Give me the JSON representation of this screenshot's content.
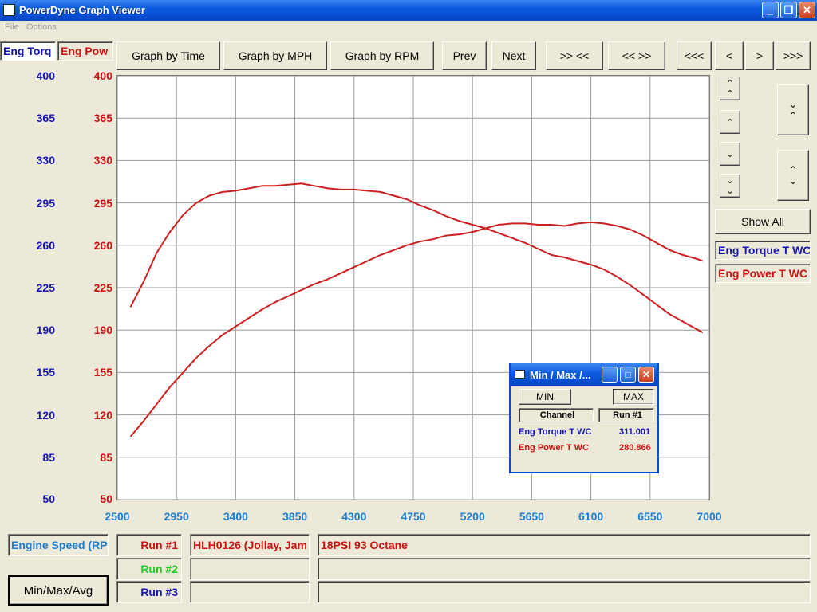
{
  "window": {
    "title": "PowerDyne Graph Viewer",
    "minimize": "_",
    "restore": "❐",
    "close": "✕"
  },
  "menu": {
    "file": "File",
    "options": "Options"
  },
  "tabs": {
    "torque": "Eng Torq",
    "power": "Eng Pow"
  },
  "toolbar": {
    "graph_time": "Graph by Time",
    "graph_mph": "Graph by MPH",
    "graph_rpm": "Graph by RPM",
    "prev": "Prev",
    "next": "Next",
    "zoom_in": ">> <<",
    "zoom_out": "<< >>",
    "scroll_far_left": "<<<",
    "scroll_left": "<",
    "scroll_right": ">",
    "scroll_far_right": ">>>"
  },
  "right_panel": {
    "show_all": "Show All",
    "legend_torque": "Eng Torque T WC",
    "legend_power": "Eng Power T WC"
  },
  "bottom": {
    "xaxis_channel": "Engine Speed (RPM)",
    "min_max_avg": "Min/Max/Avg",
    "runs": [
      {
        "label": "Run #1",
        "color": "#cc1010",
        "file": "HLH0126 (Jollay, Jam",
        "note": "18PSI 93 Octane"
      },
      {
        "label": "Run #2",
        "color": "#22cc22",
        "file": "",
        "note": ""
      },
      {
        "label": "Run #3",
        "color": "#1414b4",
        "file": "",
        "note": ""
      }
    ]
  },
  "minmax": {
    "title": "Min / Max /...",
    "min": "MIN",
    "max": "MAX",
    "col_channel": "Channel",
    "col_run": "Run #1",
    "rows": [
      {
        "channel": "Eng Torque T WC",
        "value": "311.001",
        "color": "#1414b4"
      },
      {
        "channel": "Eng Power T WC",
        "value": "280.866",
        "color": "#cc1010"
      }
    ]
  },
  "chart_data": {
    "type": "line",
    "xlim": [
      2500,
      7000
    ],
    "ylim": [
      50,
      400
    ],
    "x_ticks": [
      "2500",
      "2950",
      "3400",
      "3850",
      "4300",
      "4750",
      "5200",
      "5650",
      "6100",
      "6550",
      "7000"
    ],
    "y_ticks_torque": [
      "400",
      "365",
      "330",
      "295",
      "260",
      "225",
      "190",
      "155",
      "120",
      "85",
      "50"
    ],
    "y_ticks_power": [
      "400",
      "365",
      "330",
      "295",
      "260",
      "225",
      "190",
      "155",
      "120",
      "85",
      "50"
    ],
    "grid": true,
    "series": [
      {
        "name": "Eng Torque T WC",
        "color": "#cc2020",
        "x": [
          2600,
          2700,
          2800,
          2900,
          3000,
          3100,
          3200,
          3300,
          3400,
          3500,
          3600,
          3700,
          3800,
          3900,
          4000,
          4100,
          4200,
          4300,
          4400,
          4500,
          4600,
          4700,
          4800,
          4900,
          5000,
          5100,
          5200,
          5300,
          5400,
          5500,
          5600,
          5700,
          5800,
          5900,
          6000,
          6100,
          6200,
          6300,
          6400,
          6500,
          6600,
          6700,
          6800,
          6900,
          6950
        ],
        "y": [
          209,
          230,
          254,
          271,
          285,
          295,
          301,
          304,
          305,
          307,
          309,
          309,
          310,
          311,
          309,
          307,
          306,
          306,
          305,
          304,
          301,
          298,
          293,
          289,
          284,
          280,
          277,
          274,
          270,
          266,
          262,
          257,
          252,
          250,
          247,
          244,
          240,
          234,
          227,
          219,
          211,
          203,
          197,
          191,
          188
        ]
      },
      {
        "name": "Eng Power T WC",
        "color": "#cc2020",
        "x": [
          2600,
          2700,
          2800,
          2900,
          3000,
          3100,
          3200,
          3300,
          3400,
          3500,
          3600,
          3700,
          3800,
          3900,
          4000,
          4100,
          4200,
          4300,
          4400,
          4500,
          4600,
          4700,
          4800,
          4900,
          5000,
          5100,
          5200,
          5300,
          5400,
          5500,
          5600,
          5700,
          5800,
          5900,
          6000,
          6100,
          6200,
          6300,
          6400,
          6500,
          6600,
          6700,
          6800,
          6900,
          6950
        ],
        "y": [
          102,
          115,
          129,
          143,
          155,
          167,
          177,
          186,
          193,
          200,
          207,
          213,
          218,
          223,
          228,
          232,
          237,
          242,
          247,
          252,
          256,
          260,
          263,
          265,
          268,
          269,
          271,
          274,
          277,
          278,
          278,
          277,
          277,
          276,
          278,
          279,
          278,
          276,
          273,
          268,
          262,
          256,
          252,
          249,
          247
        ]
      }
    ]
  }
}
